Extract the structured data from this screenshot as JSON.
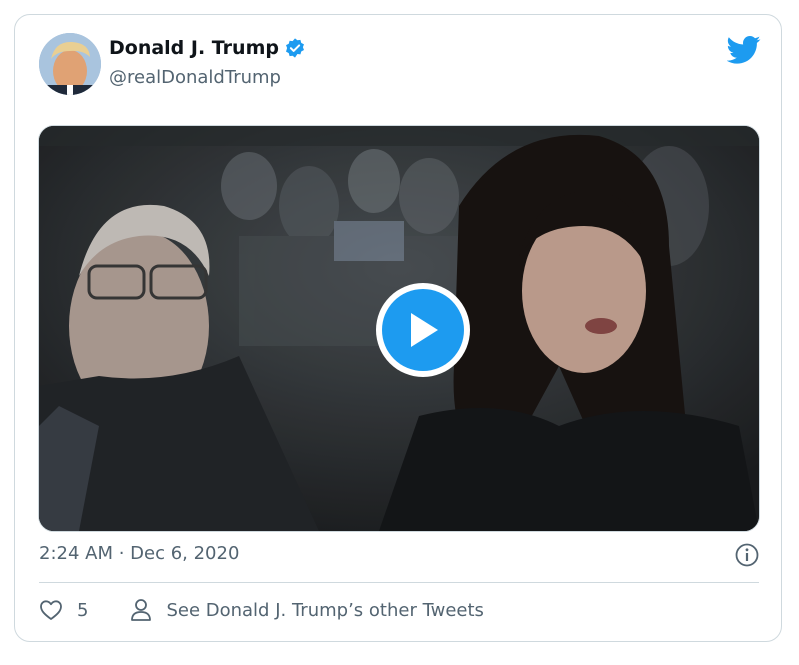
{
  "tweet": {
    "author_name": "Donald J. Trump",
    "author_handle": "@realDonaldTrump",
    "timestamp": "2:24 AM · Dec 6, 2020",
    "like_count": "5",
    "other_tweets_label": "See Donald J. Trump’s other Tweets",
    "verified": true
  },
  "icons": {
    "logo": "twitter-bird-icon",
    "verified": "verified-badge-icon",
    "play": "play-icon",
    "info": "info-icon",
    "like": "heart-icon",
    "user": "user-icon"
  },
  "colors": {
    "brand": "#1d9bf0",
    "text": "#0f1419",
    "secondary": "#536471",
    "border": "#cfd9de"
  }
}
